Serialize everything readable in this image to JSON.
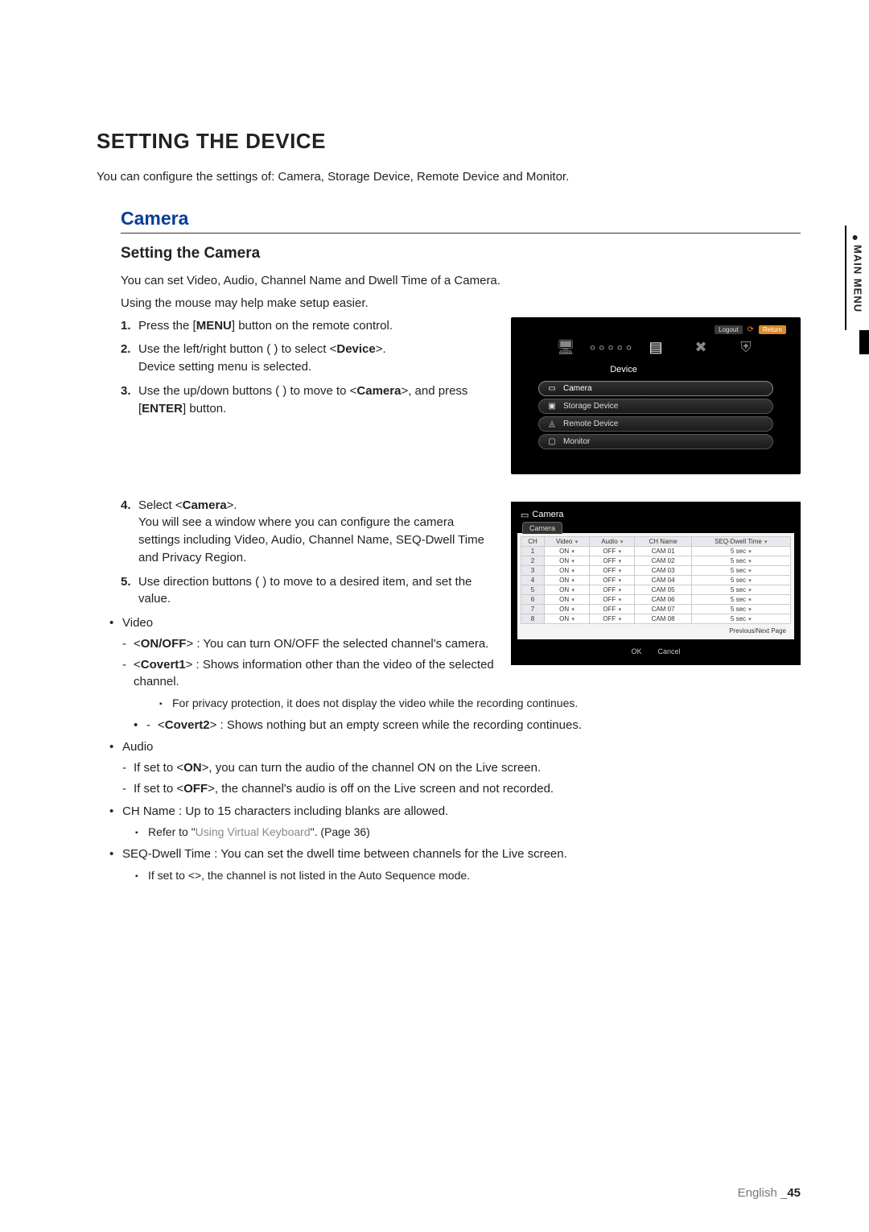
{
  "sideTab": {
    "label": "MAIN MENU"
  },
  "page": {
    "title": "SETTING THE DEVICE",
    "intro": "You can configure the settings of: Camera, Storage Device, Remote Device and Monitor.",
    "section": "Camera",
    "subsection": "Setting the Camera",
    "desc1": "You can set Video, Audio, Channel Name and Dwell Time of a Camera.",
    "desc2": "Using the mouse may help make setup easier."
  },
  "steps": {
    "s1a": "Press the [",
    "s1b": "MENU",
    "s1c": "] button on the remote control.",
    "s2a": "Use the left/right button (       ) to select <",
    "s2b": "Device",
    "s2c": ">.",
    "s2d": "Device setting menu is selected.",
    "s3a": "Use the up/down buttons (      ) to move to <",
    "s3b": "Camera",
    "s3c": ">, and press [",
    "s3d": "ENTER",
    "s3e": "] button.",
    "s4a": "Select <",
    "s4b": "Camera",
    "s4c": ">.",
    "s4d": "You will see a window where you can configure the camera settings including Video, Audio, Channel Name, SEQ-Dwell Time and Privacy Region.",
    "s5a": "Use direction buttons (          ) to move to a desired item, and set the value."
  },
  "bullets": {
    "video": "Video",
    "video_onoff_a": "<",
    "video_onoff_b": "ON/OFF",
    "video_onoff_c": "> : You can turn ON/OFF the selected channel's camera.",
    "video_c1_a": "<",
    "video_c1_b": "Covert1",
    "video_c1_c": "> : Shows information other than the video of the selected channel.",
    "video_c1_note": "For privacy protection, it does not display the video while the recording continues.",
    "video_c2_a": "<",
    "video_c2_b": "Covert2",
    "video_c2_c": "> : Shows nothing but an empty screen while the recording continues.",
    "audio": "Audio",
    "audio_on_a": "If set to <",
    "audio_on_b": "ON",
    "audio_on_c": ">, you can turn the audio of the channel ON on the Live screen.",
    "audio_off_a": "If set to <",
    "audio_off_b": "OFF",
    "audio_off_c": ">, the channel's audio is off on the Live screen and not recorded.",
    "chname": "CH Name : Up to 15 characters including blanks are allowed.",
    "chname_note_a": "Refer to \"",
    "chname_note_b": "Using Virtual Keyboard",
    "chname_note_c": "\". (Page 36)",
    "seq": "SEQ-Dwell Time : You can set the dwell time between channels for the Live screen.",
    "seq_note": "If set to <>, the channel is not listed in the Auto Sequence mode."
  },
  "screenshot1": {
    "logout": "Logout",
    "return": "Return",
    "label": "Device",
    "items": [
      "Camera",
      "Storage Device",
      "Remote Device",
      "Monitor"
    ]
  },
  "screenshot2": {
    "header": "Camera",
    "tab": "Camera",
    "cols": [
      "CH",
      "Video",
      "Audio",
      "CH Name",
      "SEQ-Dwell Time"
    ],
    "rows": [
      {
        "ch": "1",
        "v": "ON",
        "a": "OFF",
        "n": "CAM 01",
        "d": "5 sec"
      },
      {
        "ch": "2",
        "v": "ON",
        "a": "OFF",
        "n": "CAM 02",
        "d": "5 sec"
      },
      {
        "ch": "3",
        "v": "ON",
        "a": "OFF",
        "n": "CAM 03",
        "d": "5 sec"
      },
      {
        "ch": "4",
        "v": "ON",
        "a": "OFF",
        "n": "CAM 04",
        "d": "5 sec"
      },
      {
        "ch": "5",
        "v": "ON",
        "a": "OFF",
        "n": "CAM 05",
        "d": "5 sec"
      },
      {
        "ch": "6",
        "v": "ON",
        "a": "OFF",
        "n": "CAM 06",
        "d": "5 sec"
      },
      {
        "ch": "7",
        "v": "ON",
        "a": "OFF",
        "n": "CAM 07",
        "d": "5 sec"
      },
      {
        "ch": "8",
        "v": "ON",
        "a": "OFF",
        "n": "CAM 08",
        "d": "5 sec"
      }
    ],
    "pn": "Previous/Next Page",
    "ok": "OK",
    "cancel": "Cancel"
  },
  "footer": {
    "lang": "English _",
    "page": "45"
  }
}
